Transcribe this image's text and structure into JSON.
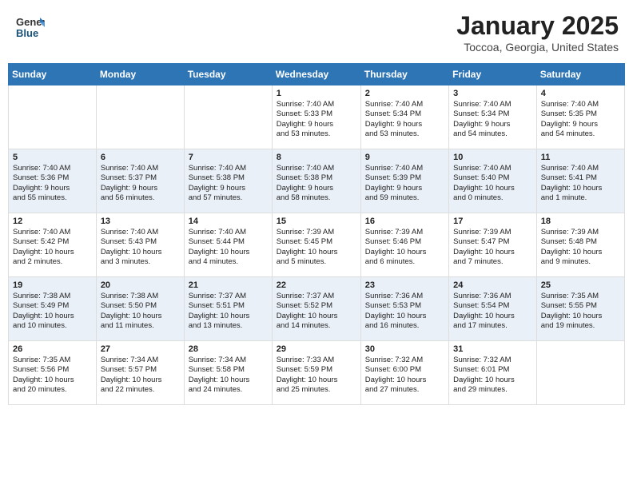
{
  "header": {
    "logo_line1": "General",
    "logo_line2": "Blue",
    "title": "January 2025",
    "subtitle": "Toccoa, Georgia, United States"
  },
  "days_of_week": [
    "Sunday",
    "Monday",
    "Tuesday",
    "Wednesday",
    "Thursday",
    "Friday",
    "Saturday"
  ],
  "weeks": [
    [
      {
        "day": "",
        "content": ""
      },
      {
        "day": "",
        "content": ""
      },
      {
        "day": "",
        "content": ""
      },
      {
        "day": "1",
        "content": "Sunrise: 7:40 AM\nSunset: 5:33 PM\nDaylight: 9 hours\nand 53 minutes."
      },
      {
        "day": "2",
        "content": "Sunrise: 7:40 AM\nSunset: 5:34 PM\nDaylight: 9 hours\nand 53 minutes."
      },
      {
        "day": "3",
        "content": "Sunrise: 7:40 AM\nSunset: 5:34 PM\nDaylight: 9 hours\nand 54 minutes."
      },
      {
        "day": "4",
        "content": "Sunrise: 7:40 AM\nSunset: 5:35 PM\nDaylight: 9 hours\nand 54 minutes."
      }
    ],
    [
      {
        "day": "5",
        "content": "Sunrise: 7:40 AM\nSunset: 5:36 PM\nDaylight: 9 hours\nand 55 minutes."
      },
      {
        "day": "6",
        "content": "Sunrise: 7:40 AM\nSunset: 5:37 PM\nDaylight: 9 hours\nand 56 minutes."
      },
      {
        "day": "7",
        "content": "Sunrise: 7:40 AM\nSunset: 5:38 PM\nDaylight: 9 hours\nand 57 minutes."
      },
      {
        "day": "8",
        "content": "Sunrise: 7:40 AM\nSunset: 5:38 PM\nDaylight: 9 hours\nand 58 minutes."
      },
      {
        "day": "9",
        "content": "Sunrise: 7:40 AM\nSunset: 5:39 PM\nDaylight: 9 hours\nand 59 minutes."
      },
      {
        "day": "10",
        "content": "Sunrise: 7:40 AM\nSunset: 5:40 PM\nDaylight: 10 hours\nand 0 minutes."
      },
      {
        "day": "11",
        "content": "Sunrise: 7:40 AM\nSunset: 5:41 PM\nDaylight: 10 hours\nand 1 minute."
      }
    ],
    [
      {
        "day": "12",
        "content": "Sunrise: 7:40 AM\nSunset: 5:42 PM\nDaylight: 10 hours\nand 2 minutes."
      },
      {
        "day": "13",
        "content": "Sunrise: 7:40 AM\nSunset: 5:43 PM\nDaylight: 10 hours\nand 3 minutes."
      },
      {
        "day": "14",
        "content": "Sunrise: 7:40 AM\nSunset: 5:44 PM\nDaylight: 10 hours\nand 4 minutes."
      },
      {
        "day": "15",
        "content": "Sunrise: 7:39 AM\nSunset: 5:45 PM\nDaylight: 10 hours\nand 5 minutes."
      },
      {
        "day": "16",
        "content": "Sunrise: 7:39 AM\nSunset: 5:46 PM\nDaylight: 10 hours\nand 6 minutes."
      },
      {
        "day": "17",
        "content": "Sunrise: 7:39 AM\nSunset: 5:47 PM\nDaylight: 10 hours\nand 7 minutes."
      },
      {
        "day": "18",
        "content": "Sunrise: 7:39 AM\nSunset: 5:48 PM\nDaylight: 10 hours\nand 9 minutes."
      }
    ],
    [
      {
        "day": "19",
        "content": "Sunrise: 7:38 AM\nSunset: 5:49 PM\nDaylight: 10 hours\nand 10 minutes."
      },
      {
        "day": "20",
        "content": "Sunrise: 7:38 AM\nSunset: 5:50 PM\nDaylight: 10 hours\nand 11 minutes."
      },
      {
        "day": "21",
        "content": "Sunrise: 7:37 AM\nSunset: 5:51 PM\nDaylight: 10 hours\nand 13 minutes."
      },
      {
        "day": "22",
        "content": "Sunrise: 7:37 AM\nSunset: 5:52 PM\nDaylight: 10 hours\nand 14 minutes."
      },
      {
        "day": "23",
        "content": "Sunrise: 7:36 AM\nSunset: 5:53 PM\nDaylight: 10 hours\nand 16 minutes."
      },
      {
        "day": "24",
        "content": "Sunrise: 7:36 AM\nSunset: 5:54 PM\nDaylight: 10 hours\nand 17 minutes."
      },
      {
        "day": "25",
        "content": "Sunrise: 7:35 AM\nSunset: 5:55 PM\nDaylight: 10 hours\nand 19 minutes."
      }
    ],
    [
      {
        "day": "26",
        "content": "Sunrise: 7:35 AM\nSunset: 5:56 PM\nDaylight: 10 hours\nand 20 minutes."
      },
      {
        "day": "27",
        "content": "Sunrise: 7:34 AM\nSunset: 5:57 PM\nDaylight: 10 hours\nand 22 minutes."
      },
      {
        "day": "28",
        "content": "Sunrise: 7:34 AM\nSunset: 5:58 PM\nDaylight: 10 hours\nand 24 minutes."
      },
      {
        "day": "29",
        "content": "Sunrise: 7:33 AM\nSunset: 5:59 PM\nDaylight: 10 hours\nand 25 minutes."
      },
      {
        "day": "30",
        "content": "Sunrise: 7:32 AM\nSunset: 6:00 PM\nDaylight: 10 hours\nand 27 minutes."
      },
      {
        "day": "31",
        "content": "Sunrise: 7:32 AM\nSunset: 6:01 PM\nDaylight: 10 hours\nand 29 minutes."
      },
      {
        "day": "",
        "content": ""
      }
    ]
  ]
}
